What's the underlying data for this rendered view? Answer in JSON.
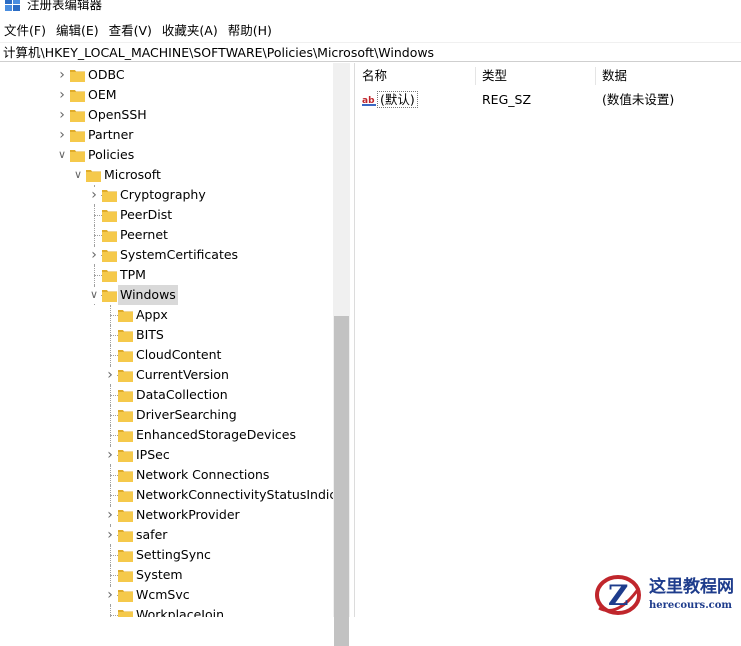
{
  "window": {
    "title": "注册表编辑器"
  },
  "menu": [
    "文件(F)",
    "编辑(E)",
    "查看(V)",
    "收藏夹(A)",
    "帮助(H)"
  ],
  "address": "计算机\\HKEY_LOCAL_MACHINE\\SOFTWARE\\Policies\\Microsoft\\Windows",
  "tree": [
    {
      "label": "ODBC",
      "level": 0,
      "expander": "collapsed"
    },
    {
      "label": "OEM",
      "level": 0,
      "expander": "collapsed"
    },
    {
      "label": "OpenSSH",
      "level": 0,
      "expander": "collapsed"
    },
    {
      "label": "Partner",
      "level": 0,
      "expander": "collapsed"
    },
    {
      "label": "Policies",
      "level": 0,
      "expander": "expanded"
    },
    {
      "label": "Microsoft",
      "level": 1,
      "expander": "expanded"
    },
    {
      "label": "Cryptography",
      "level": 2,
      "expander": "collapsed"
    },
    {
      "label": "PeerDist",
      "level": 2,
      "expander": "none"
    },
    {
      "label": "Peernet",
      "level": 2,
      "expander": "none"
    },
    {
      "label": "SystemCertificates",
      "level": 2,
      "expander": "collapsed"
    },
    {
      "label": "TPM",
      "level": 2,
      "expander": "none"
    },
    {
      "label": "Windows",
      "level": 2,
      "expander": "expanded",
      "selected": true
    },
    {
      "label": "Appx",
      "level": 3,
      "expander": "none"
    },
    {
      "label": "BITS",
      "level": 3,
      "expander": "none"
    },
    {
      "label": "CloudContent",
      "level": 3,
      "expander": "none"
    },
    {
      "label": "CurrentVersion",
      "level": 3,
      "expander": "collapsed"
    },
    {
      "label": "DataCollection",
      "level": 3,
      "expander": "none"
    },
    {
      "label": "DriverSearching",
      "level": 3,
      "expander": "none"
    },
    {
      "label": "EnhancedStorageDevices",
      "level": 3,
      "expander": "none"
    },
    {
      "label": "IPSec",
      "level": 3,
      "expander": "collapsed"
    },
    {
      "label": "Network Connections",
      "level": 3,
      "expander": "none"
    },
    {
      "label": "NetworkConnectivityStatusIndicato",
      "level": 3,
      "expander": "none"
    },
    {
      "label": "NetworkProvider",
      "level": 3,
      "expander": "collapsed"
    },
    {
      "label": "safer",
      "level": 3,
      "expander": "collapsed"
    },
    {
      "label": "SettingSync",
      "level": 3,
      "expander": "none"
    },
    {
      "label": "System",
      "level": 3,
      "expander": "none"
    },
    {
      "label": "WcmSvc",
      "level": 3,
      "expander": "collapsed"
    },
    {
      "label": "WorkplaceJoin",
      "level": 3,
      "expander": "none"
    }
  ],
  "values_pane": {
    "headers": {
      "name": "名称",
      "type": "类型",
      "data": "数据"
    },
    "rows": [
      {
        "icon": "ab",
        "name": "(默认)",
        "type": "REG_SZ",
        "data": "(数值未设置)"
      }
    ]
  },
  "watermark": {
    "letter": "Z",
    "cn": "这里教程网",
    "url": "herecours.com"
  },
  "colors": {
    "folder": "#f5c94b",
    "folder_dark": "#e0ac2a",
    "selection": "#d9d9d9",
    "watermark_red": "#c0262c",
    "watermark_blue": "#1e3c8c"
  }
}
